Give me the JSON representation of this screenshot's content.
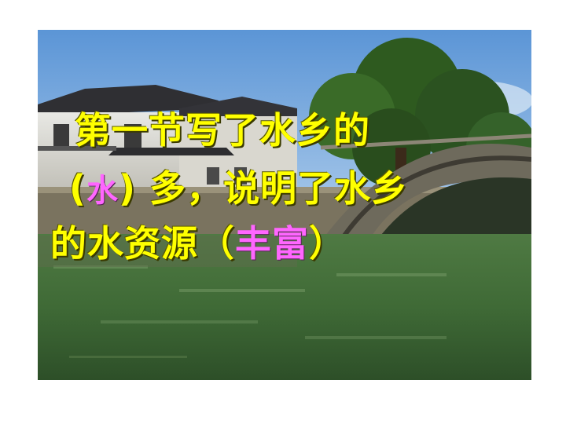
{
  "slide": {
    "line1": "第一节写了水乡的",
    "line2_open": "(",
    "line2_answer": "水",
    "line2_close": ")",
    "line2_rest": "多，说明了水乡",
    "line3_start": "的水资源（",
    "line3_answer": "丰富",
    "line3_close": "）"
  },
  "colors": {
    "text": "#ffff00",
    "answer": "#ff66ff",
    "water": "#3f6b3a",
    "sky": "#6fa8dc"
  }
}
